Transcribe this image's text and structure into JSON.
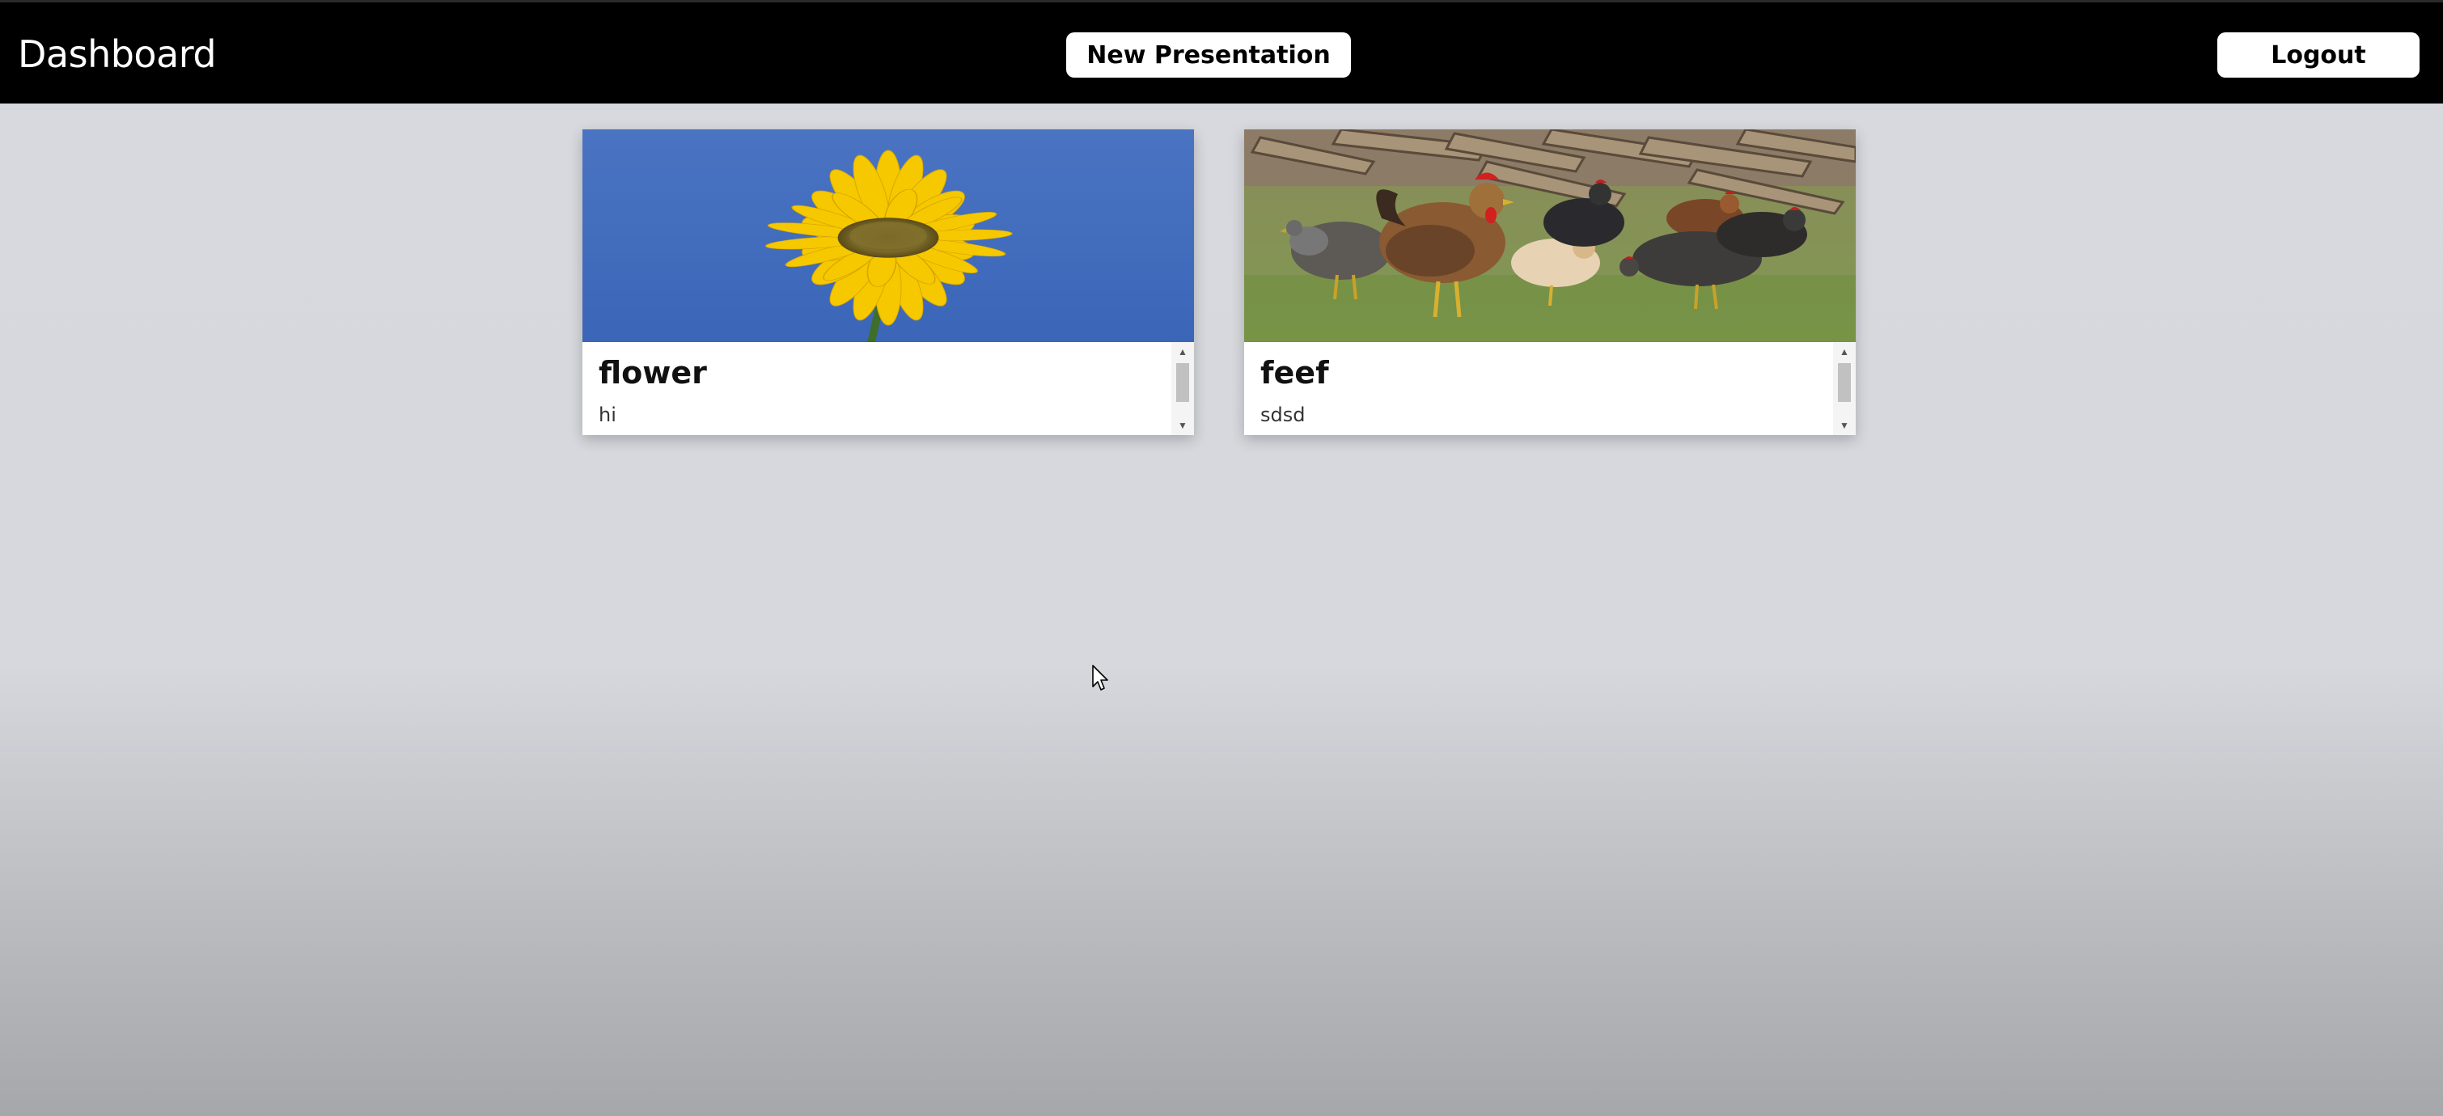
{
  "header": {
    "title": "Dashboard",
    "new_presentation_label": "New Presentation",
    "logout_label": "Logout"
  },
  "presentations": [
    {
      "title": "flower",
      "description": "hi",
      "thumbnail_icon": "sunflower-thumbnail"
    },
    {
      "title": "feef",
      "description": "sdsd",
      "thumbnail_icon": "chickens-thumbnail"
    }
  ],
  "colors": {
    "header_bg": "#000000",
    "page_bg": "#d7d9de",
    "button_bg": "#ffffff",
    "card_bg": "#ffffff"
  }
}
